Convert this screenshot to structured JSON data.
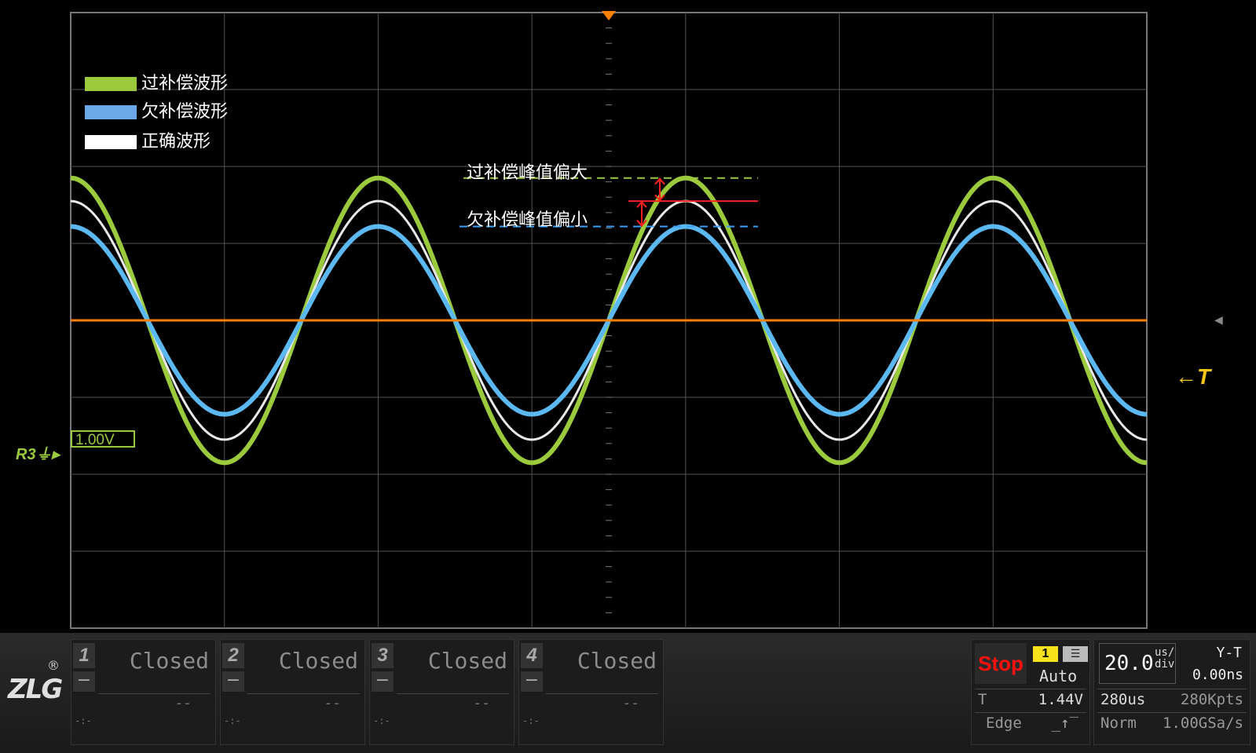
{
  "legend": [
    {
      "label": "过补偿波形",
      "color": "#9bcb3c"
    },
    {
      "label": "欠补偿波形",
      "color": "#6aa8e8"
    },
    {
      "label": "正确波形",
      "color": "#ffffff"
    }
  ],
  "annotations": {
    "over": "过补偿峰值偏大",
    "under": "欠补偿峰值偏小"
  },
  "colors": {
    "over": "#9bcb3c",
    "under": "#5bb8f0",
    "correct": "#e8e8e8",
    "trigger": "#ff7f00",
    "grid": "#555555",
    "marker": "#ff2020"
  },
  "ref_channel": {
    "label": "R3",
    "scale": "1.00V"
  },
  "trigger_marker": "T",
  "channels": [
    {
      "num": "1",
      "status": "Closed",
      "value": "--",
      "small": "-:-"
    },
    {
      "num": "2",
      "status": "Closed",
      "value": "--",
      "small": "-:-"
    },
    {
      "num": "3",
      "status": "Closed",
      "value": "--",
      "small": "-:-"
    },
    {
      "num": "4",
      "status": "Closed",
      "value": "--",
      "small": "-:-"
    }
  ],
  "logo": "ZLG",
  "logo_reg": "®",
  "trigger": {
    "state": "Stop",
    "source": "1",
    "mode": "Auto",
    "type_label": "T",
    "level": "1.44V",
    "slope_label": "Edge"
  },
  "timebase": {
    "value": "20.0",
    "unit_top": "us/",
    "unit_bottom": "div",
    "mode": "Y-T",
    "position": "0.00ns",
    "record_time": "280us",
    "record_length": "280Kpts",
    "acq_mode": "Norm",
    "sample_rate": "1.00GSa/s"
  },
  "chart_data": {
    "type": "line",
    "title": "",
    "xlabel": "",
    "ylabel": "",
    "xlim": [
      0,
      7
    ],
    "ylim": [
      -4,
      4
    ],
    "x_unit": "div",
    "y_unit": "div",
    "grid": true,
    "period_div": 2,
    "series": [
      {
        "name": "过补偿波形",
        "amplitude_div": 1.85,
        "phase_offset_div": 0.0
      },
      {
        "name": "正确波形",
        "amplitude_div": 1.55,
        "phase_offset_div": 0.0
      },
      {
        "name": "欠补偿波形",
        "amplitude_div": 1.22,
        "phase_offset_div": 0.0
      }
    ]
  }
}
